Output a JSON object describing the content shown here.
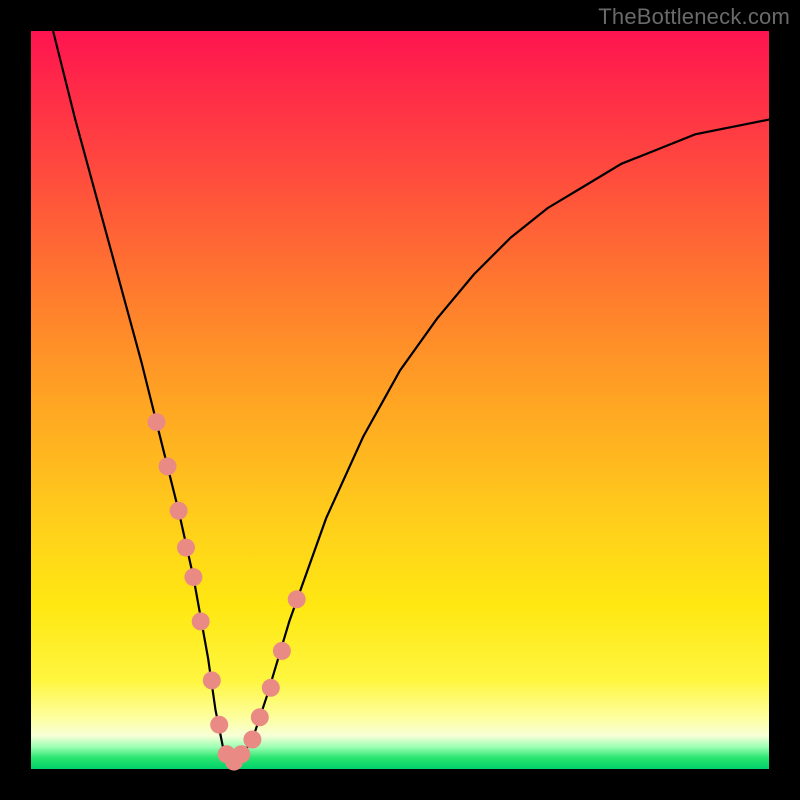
{
  "watermark": "TheBottleneck.com",
  "chart_data": {
    "type": "line",
    "title": "",
    "xlabel": "",
    "ylabel": "",
    "xlim": [
      0,
      100
    ],
    "ylim": [
      0,
      100
    ],
    "series": [
      {
        "name": "bottleneck-curve",
        "x": [
          3,
          6,
          9,
          12,
          15,
          18,
          20,
          22,
          24,
          25,
          26,
          27,
          28,
          30,
          32,
          35,
          40,
          45,
          50,
          55,
          60,
          65,
          70,
          75,
          80,
          85,
          90,
          95,
          100
        ],
        "values": [
          100,
          88,
          77,
          66,
          55,
          43,
          35,
          26,
          15,
          8,
          3,
          1,
          1,
          4,
          10,
          20,
          34,
          45,
          54,
          61,
          67,
          72,
          76,
          79,
          82,
          84,
          86,
          87,
          88
        ]
      }
    ],
    "markers": {
      "name": "highlight-dots",
      "x": [
        17,
        18.5,
        20,
        21,
        22,
        23,
        24.5,
        25.5,
        26.5,
        27.5,
        28.5,
        30,
        31,
        32.5,
        34,
        36
      ],
      "values": [
        47,
        41,
        35,
        30,
        26,
        20,
        12,
        6,
        2,
        1,
        2,
        4,
        7,
        11,
        16,
        23
      ],
      "color": "#e98b84",
      "radius": 9
    },
    "gradient_bands": [
      {
        "name": "red",
        "from_y": 100,
        "to_y": 60
      },
      {
        "name": "orange",
        "from_y": 60,
        "to_y": 30
      },
      {
        "name": "yellow",
        "from_y": 30,
        "to_y": 7
      },
      {
        "name": "pale",
        "from_y": 7,
        "to_y": 3
      },
      {
        "name": "green",
        "from_y": 3,
        "to_y": 0
      }
    ]
  }
}
